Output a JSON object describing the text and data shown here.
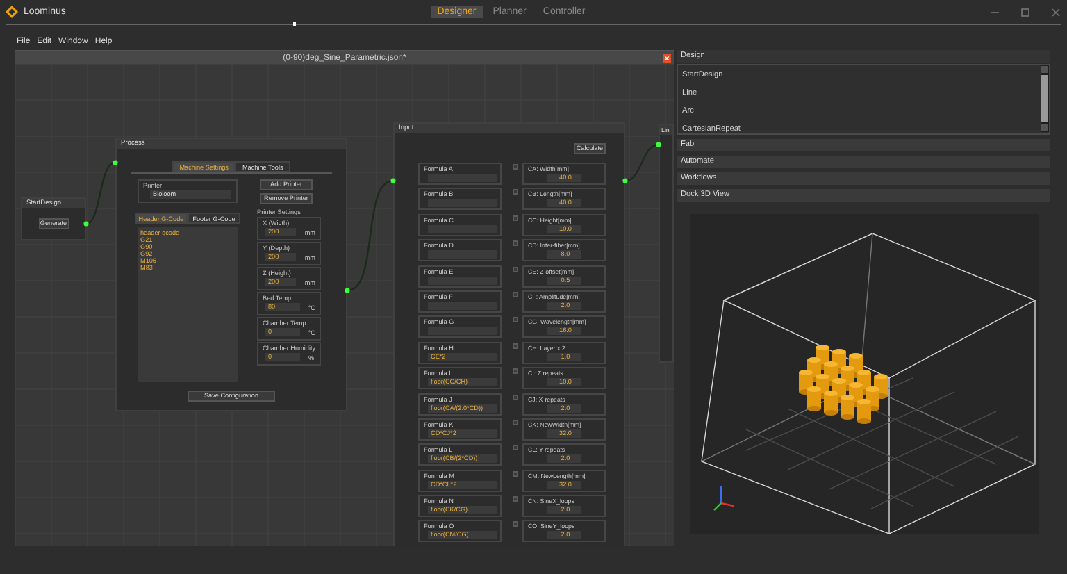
{
  "app": {
    "title": "Loominus"
  },
  "mode_tabs": [
    {
      "label": "Designer",
      "selected": true
    },
    {
      "label": "Planner",
      "selected": false
    },
    {
      "label": "Controller",
      "selected": false
    }
  ],
  "menu": [
    "File",
    "Edit",
    "Window",
    "Help"
  ],
  "editor": {
    "title": "(0-90)deg_Sine_Parametric.json*"
  },
  "start_node": {
    "title": "StartDesign",
    "button": "Generate"
  },
  "process_node": {
    "title": "Process",
    "tabs": [
      {
        "label": "Machine Settings",
        "selected": true
      },
      {
        "label": "Machine Tools",
        "selected": false
      }
    ],
    "printer": {
      "label": "Printer",
      "value": "Bioloom"
    },
    "buttons": [
      "Add Printer",
      "Remove Printer"
    ],
    "gcode_tabs": [
      {
        "label": "Header G-Code",
        "selected": true
      },
      {
        "label": "Footer G-Code",
        "selected": false
      }
    ],
    "gcode_lines": [
      "header gcode",
      "G21",
      "G90",
      "G92",
      "M105",
      "M83"
    ],
    "settings_title": "Printer Settings",
    "settings": [
      {
        "label": "X (Width)",
        "value": "200",
        "unit": "mm"
      },
      {
        "label": "Y (Depth)",
        "value": "200",
        "unit": "mm"
      },
      {
        "label": "Z (Height)",
        "value": "200",
        "unit": "mm"
      },
      {
        "label": "Bed Temp",
        "value": "80",
        "unit": "°C"
      },
      {
        "label": "Chamber Temp",
        "value": "0",
        "unit": "°C"
      },
      {
        "label": "Chamber Humidity",
        "value": "0",
        "unit": "%"
      }
    ],
    "save_button": "Save Configuration"
  },
  "input_node": {
    "title": "Input",
    "button": "Calculate",
    "formulas": [
      {
        "label": "Formula A"
      },
      {
        "label": "Formula B"
      },
      {
        "label": "Formula C"
      },
      {
        "label": "Formula D"
      },
      {
        "label": "Formula E"
      },
      {
        "label": "Formula F"
      },
      {
        "label": "Formula G"
      },
      {
        "label": "Formula H",
        "value": "CE*2"
      },
      {
        "label": "Formula I",
        "value": "floor(CC/CH)"
      },
      {
        "label": "Formula J",
        "value": "floor(CA/(2.0*CD))"
      },
      {
        "label": "Formula K",
        "value": "CD*CJ*2"
      },
      {
        "label": "Formula L",
        "value": "floor(CB/(2*CD))"
      },
      {
        "label": "Formula M",
        "value": "CD*CL*2"
      },
      {
        "label": "Formula N",
        "value": "floor(CK/CG)"
      },
      {
        "label": "Formula O",
        "value": "floor(CM/CG)"
      }
    ],
    "params": [
      {
        "label": "CA: Width[mm]",
        "value": "40.0",
        "checked": false
      },
      {
        "label": "CB: Length[mm]",
        "value": "40.0",
        "checked": false
      },
      {
        "label": "CC: Height[mm]",
        "value": "10.0",
        "checked": false
      },
      {
        "label": "CD: Inter-fiber[mm]",
        "value": "8.0",
        "checked": false
      },
      {
        "label": "CE: Z-offset[mm]",
        "value": "0.5",
        "checked": false
      },
      {
        "label": "CF: Amplitude[mm]",
        "value": "2.0",
        "checked": false
      },
      {
        "label": "CG: Wavelength[mm]",
        "value": "16.0",
        "checked": false
      },
      {
        "label": "CH: Layer  x 2",
        "value": "1.0",
        "checked": false
      },
      {
        "label": "CI: Z repeats",
        "value": "10.0",
        "checked": false
      },
      {
        "label": "CJ: X-repeats",
        "value": "2.0",
        "checked": false
      },
      {
        "label": "CK: NewWidth[mm]",
        "value": "32.0",
        "checked": false
      },
      {
        "label": "CL: Y-repeats",
        "value": "2.0",
        "checked": false
      },
      {
        "label": "CM: NewLength[mm]",
        "value": "32.0",
        "checked": false
      },
      {
        "label": "CN: SineX_loops",
        "value": "2.0",
        "checked": false
      },
      {
        "label": "CO: SineY_loops",
        "value": "2.0",
        "checked": false
      }
    ]
  },
  "line_node": {
    "title": "Lin"
  },
  "panel": {
    "sections": [
      {
        "title": "Design",
        "items": [
          "StartDesign",
          "Line",
          "Arc",
          "CartesianRepeat"
        ]
      },
      {
        "title": "Fab"
      },
      {
        "title": "Automate"
      },
      {
        "title": "Workflows"
      },
      {
        "title": "Dock 3D View"
      }
    ]
  }
}
